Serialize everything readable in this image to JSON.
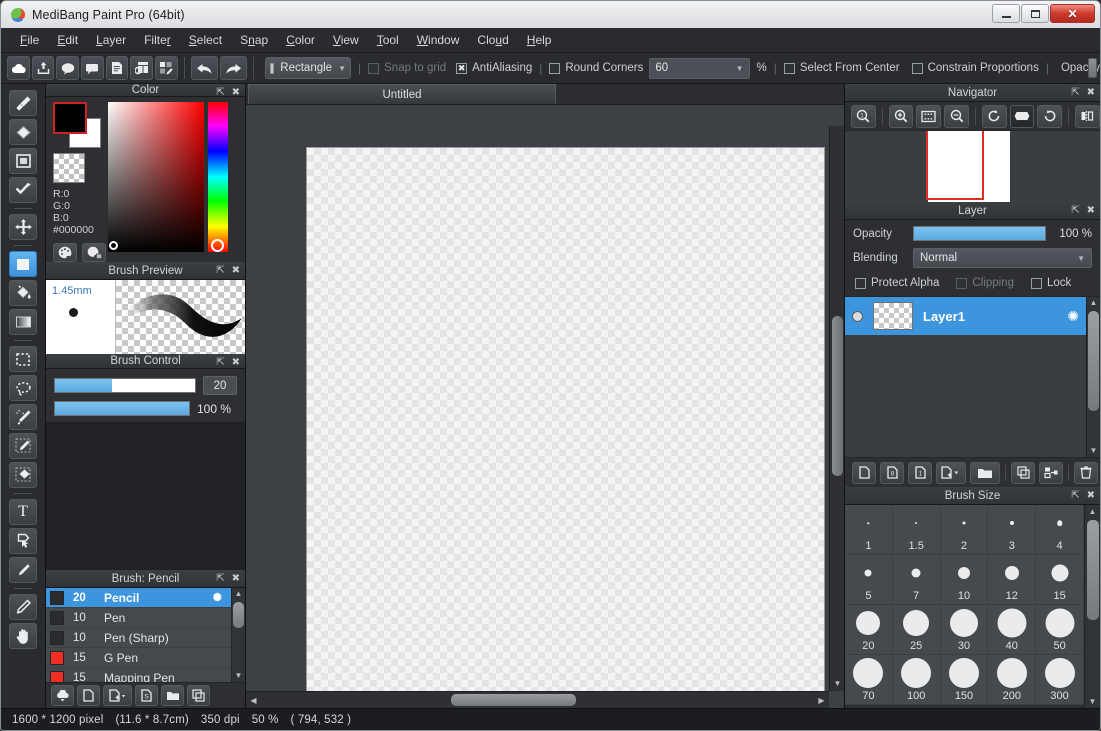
{
  "window": {
    "title": "MediBang Paint Pro (64bit)",
    "logo_icon": "medibang-logo-icon",
    "minimize_label": "",
    "maximize_label": "",
    "close_label": "✕"
  },
  "menubar": {
    "items": [
      {
        "label": "File",
        "accel": "F"
      },
      {
        "label": "Edit",
        "accel": "E"
      },
      {
        "label": "Layer",
        "accel": "L"
      },
      {
        "label": "Filter",
        "accel": "r"
      },
      {
        "label": "Select",
        "accel": "S"
      },
      {
        "label": "Snap",
        "accel": "n"
      },
      {
        "label": "Color",
        "accel": "C"
      },
      {
        "label": "View",
        "accel": "V"
      },
      {
        "label": "Tool",
        "accel": "T"
      },
      {
        "label": "Window",
        "accel": "W"
      },
      {
        "label": "Cloud",
        "accel": "u"
      },
      {
        "label": "Help",
        "accel": "H"
      }
    ]
  },
  "toolbar": {
    "buttons": [
      {
        "icon": "cloud-icon",
        "name": "cloud-button"
      },
      {
        "icon": "upload-icon",
        "name": "upload-button"
      },
      {
        "icon": "comment-bubble-icon",
        "name": "comment-button"
      },
      {
        "icon": "speech-balloon-icon",
        "name": "balloon-button"
      },
      {
        "icon": "document-icon",
        "name": "document-button"
      },
      {
        "icon": "panel-layout-icon",
        "name": "panel-layout-button"
      },
      {
        "icon": "grid-edit-icon",
        "name": "grid-edit-button"
      }
    ],
    "undo_icon": "undo-arrow-icon",
    "redo_icon": "redo-arrow-icon"
  },
  "options_bar": {
    "shape": {
      "label": "Rectangle",
      "swatch_icon": "filled-square-icon",
      "caret_icon": "chevron-down-icon"
    },
    "snap_to_grid": {
      "label": "Snap to grid",
      "checked": false,
      "enabled": false
    },
    "antialiasing": {
      "label": "AntiAliasing",
      "checked": true,
      "mark": "✖"
    },
    "round_corners": {
      "label": "Round Corners",
      "checked": false
    },
    "corner_value": "60",
    "percent_sign": "%",
    "select_from_center": {
      "label": "Select From Center",
      "checked": false
    },
    "constrain_proportions": {
      "label": "Constrain Proportions",
      "checked": false
    },
    "opacity_label": "Opacity"
  },
  "tools": [
    {
      "name": "brush-tool",
      "icon": "brush-icon",
      "active": false
    },
    {
      "name": "eraser-tool",
      "icon": "eraser-diamond-icon",
      "active": false
    },
    {
      "name": "shape-tool",
      "icon": "square-outline-icon",
      "active": false
    },
    {
      "name": "polyline-tool",
      "icon": "polyline-icon",
      "active": false
    },
    {
      "name": "move-tool",
      "icon": "move-arrows-icon",
      "active": false
    },
    {
      "name": "rectangle-select-tool",
      "icon": "filled-square-icon",
      "active": true
    },
    {
      "name": "bucket-fill-tool",
      "icon": "paint-bucket-icon",
      "active": false
    },
    {
      "name": "gradient-tool",
      "icon": "gradient-icon",
      "active": false
    },
    {
      "name": "marquee-select-tool",
      "icon": "dashed-rect-icon",
      "active": false
    },
    {
      "name": "lasso-select-tool",
      "icon": "lasso-icon",
      "active": false
    },
    {
      "name": "magic-wand-tool",
      "icon": "magic-wand-icon",
      "active": false
    },
    {
      "name": "select-pen-tool",
      "icon": "select-pen-icon",
      "active": false
    },
    {
      "name": "select-eraser-tool",
      "icon": "select-eraser-icon",
      "active": false
    },
    {
      "name": "text-tool",
      "icon": "text-t-icon",
      "active": false
    },
    {
      "name": "operation-tool",
      "icon": "cursor-arrow-icon",
      "active": false
    },
    {
      "name": "eyedropper-tool",
      "icon": "eyedropper-icon",
      "active": false
    },
    {
      "name": "pen-tool",
      "icon": "pen-icon",
      "active": false
    },
    {
      "name": "hand-tool",
      "icon": "hand-icon",
      "active": false
    }
  ],
  "color_panel": {
    "title": "Color",
    "popout_icon": "popout-icon",
    "close_icon": "close-icon",
    "r": "R:0",
    "g": "G:0",
    "b": "B:0",
    "hex": "#000000",
    "foreground_color": "#000000",
    "background_color": "#ffffff",
    "palette_button_icon": "palette-icon",
    "palette_list_button_icon": "palette-list-icon"
  },
  "brush_preview": {
    "title": "Brush Preview",
    "size_mm": "1.45mm",
    "popout_icon": "popout-icon",
    "close_icon": "close-icon"
  },
  "brush_control": {
    "title": "Brush Control",
    "size_value": "20",
    "size_fill_percent": 41,
    "opacity_value": "100 %",
    "opacity_fill_percent": 100,
    "popout_icon": "popout-icon",
    "close_icon": "close-icon"
  },
  "brush_list": {
    "title": "Brush: Pencil",
    "popout_icon": "popout-icon",
    "close_icon": "close-icon",
    "gear_icon": "gear-icon",
    "items": [
      {
        "size": "20",
        "label": "Pencil",
        "color": "#2a2c30",
        "selected": true
      },
      {
        "size": "10",
        "label": "Pen",
        "color": "#2a2c30",
        "selected": false
      },
      {
        "size": "10",
        "label": "Pen (Sharp)",
        "color": "#2a2c30",
        "selected": false
      },
      {
        "size": "15",
        "label": "G Pen",
        "color": "#f22d21",
        "selected": false
      },
      {
        "size": "15",
        "label": "Mapping Pen",
        "color": "#f22d21",
        "selected": false
      }
    ],
    "tool_buttons": [
      {
        "name": "download-brush-button",
        "icon": "cloud-download-icon"
      },
      {
        "name": "new-brush-button",
        "icon": "new-page-icon"
      },
      {
        "name": "add-brush-button",
        "icon": "add-page-dropdown-icon"
      },
      {
        "name": "script-brush-button",
        "icon": "script-page-icon"
      },
      {
        "name": "brush-folder-button",
        "icon": "folder-icon"
      },
      {
        "name": "duplicate-brush-button",
        "icon": "duplicate-icon"
      }
    ]
  },
  "canvas": {
    "tab_label": "Untitled",
    "h_scroll_left_icon": "triangle-left-icon",
    "h_scroll_right_icon": "triangle-right-icon",
    "v_scroll_up_icon": "triangle-up-icon",
    "v_scroll_down_icon": "triangle-down-icon"
  },
  "navigator": {
    "title": "Navigator",
    "popout_icon": "popout-icon",
    "close_icon": "close-icon",
    "buttons": [
      {
        "name": "zoom-actual-size-button",
        "icon": "zoom-one-icon"
      },
      {
        "name": "zoom-in-button",
        "icon": "zoom-in-icon"
      },
      {
        "name": "fit-to-screen-button",
        "icon": "fit-screen-icon"
      },
      {
        "name": "zoom-out-button",
        "icon": "zoom-out-icon"
      },
      {
        "name": "rotate-left-button",
        "icon": "rotate-left-icon"
      },
      {
        "name": "reset-rotation-button",
        "icon": "reset-rotation-icon"
      },
      {
        "name": "rotate-right-button",
        "icon": "rotate-right-icon"
      },
      {
        "name": "flip-horizontal-button",
        "icon": "flip-horizontal-icon"
      }
    ]
  },
  "layer_panel": {
    "title": "Layer",
    "popout_icon": "popout-icon",
    "close_icon": "close-icon",
    "opacity_label": "Opacity",
    "opacity_value": "100 %",
    "opacity_fill_percent": 100,
    "blending_label": "Blending",
    "blending_value": "Normal",
    "blending_caret_icon": "chevron-down-icon",
    "checks": [
      {
        "label": "Protect Alpha",
        "checked": false,
        "enabled": true
      },
      {
        "label": "Clipping",
        "checked": false,
        "enabled": false
      },
      {
        "label": "Lock",
        "checked": false,
        "enabled": true
      }
    ],
    "layers": [
      {
        "name": "Layer1",
        "visible": true,
        "selected": true,
        "gear_icon": "gear-icon"
      }
    ],
    "tool_buttons": [
      {
        "name": "add-layer-button",
        "icon": "new-page-icon"
      },
      {
        "name": "add-8bit-layer-button",
        "icon": "page-8bit-icon"
      },
      {
        "name": "add-1bit-layer-button",
        "icon": "page-1bit-icon"
      },
      {
        "name": "add-layer-dropdown-button",
        "icon": "add-page-dropdown-icon"
      },
      {
        "name": "new-folder-button",
        "icon": "folder-icon"
      },
      {
        "name": "duplicate-layer-button",
        "icon": "duplicate-icon"
      },
      {
        "name": "merge-layer-button",
        "icon": "merge-layers-icon"
      },
      {
        "name": "delete-layer-button",
        "icon": "trash-icon"
      }
    ]
  },
  "brush_size_panel": {
    "title": "Brush Size",
    "popout_icon": "popout-icon",
    "close_icon": "close-icon",
    "sizes": [
      {
        "label": "1",
        "dot": 1.5
      },
      {
        "label": "1.5",
        "dot": 2
      },
      {
        "label": "2",
        "dot": 3
      },
      {
        "label": "3",
        "dot": 4
      },
      {
        "label": "4",
        "dot": 5.5
      },
      {
        "label": "5",
        "dot": 7
      },
      {
        "label": "7",
        "dot": 9
      },
      {
        "label": "10",
        "dot": 12
      },
      {
        "label": "12",
        "dot": 14
      },
      {
        "label": "15",
        "dot": 17
      },
      {
        "label": "20",
        "dot": 24
      },
      {
        "label": "25",
        "dot": 26
      },
      {
        "label": "30",
        "dot": 28
      },
      {
        "label": "40",
        "dot": 29
      },
      {
        "label": "50",
        "dot": 29
      },
      {
        "label": "70",
        "dot": 30
      },
      {
        "label": "100",
        "dot": 30
      },
      {
        "label": "150",
        "dot": 30
      },
      {
        "label": "200",
        "dot": 30
      },
      {
        "label": "300",
        "dot": 30
      }
    ]
  },
  "statusbar": {
    "dimensions": "1600 * 1200 pixel",
    "physical": "(11.6 * 8.7cm)",
    "dpi": "350 dpi",
    "zoom": "50 %",
    "cursor": "( 794, 532 )"
  }
}
